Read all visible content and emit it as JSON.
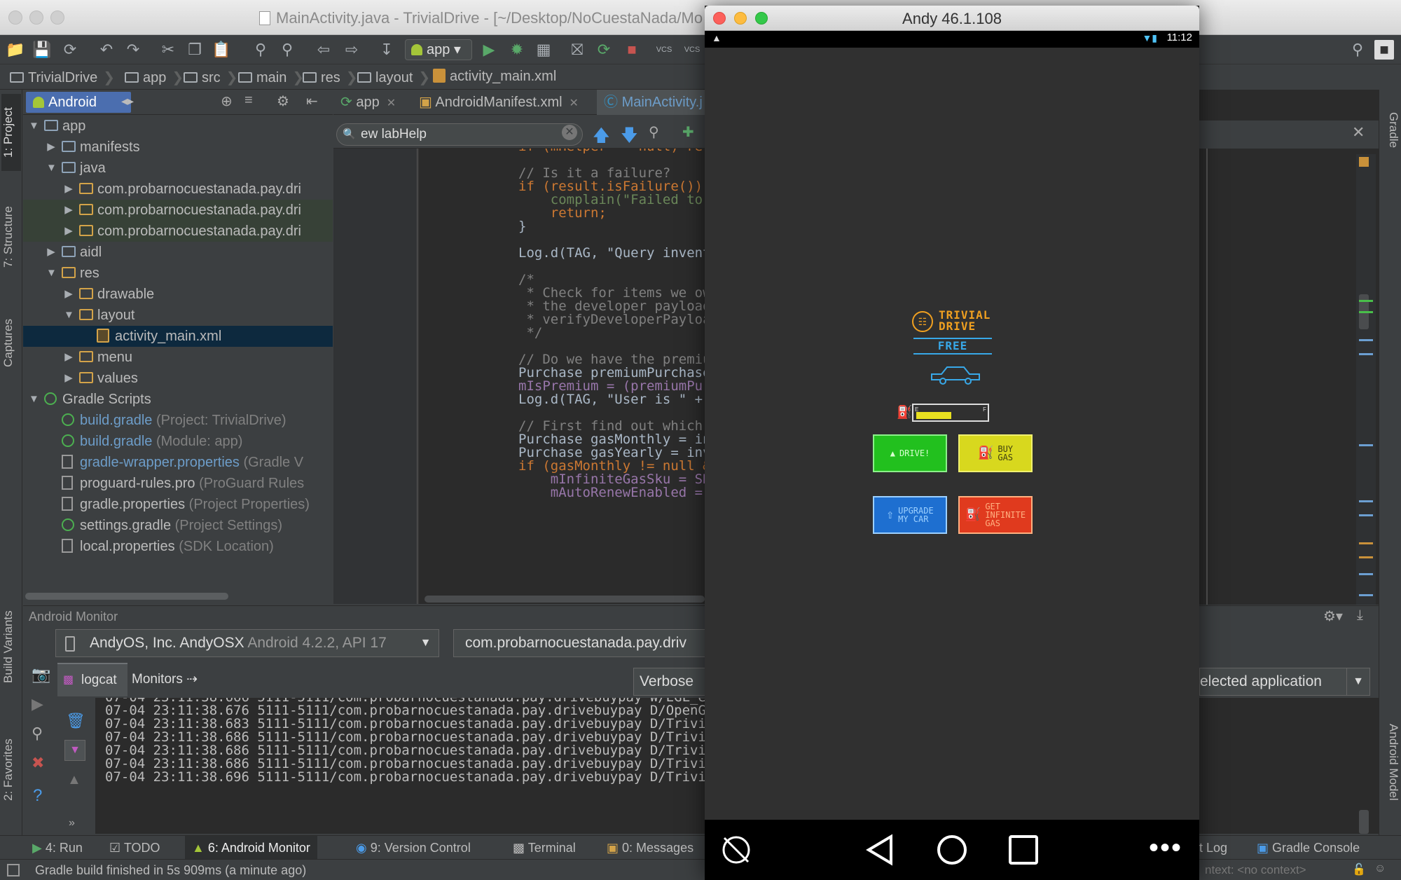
{
  "ide": {
    "window_title": "MainActivity.java - TrivialDrive - [~/Desktop/NoCuestaNada/Mo",
    "run_config": "app",
    "vcs_labels": [
      "VCS",
      "VCS"
    ],
    "breadcrumbs": [
      "TrivialDrive",
      "app",
      "src",
      "main",
      "res",
      "layout",
      "activity_main.xml"
    ],
    "left_tabs": [
      "1: Project",
      "7: Structure",
      "Captures",
      "Build Variants",
      "2: Favorites"
    ],
    "right_tabs": [
      "Gradle",
      "Android Model"
    ],
    "project_view": "Android",
    "tree": [
      {
        "label": "app",
        "hint": ""
      },
      {
        "label": "manifests",
        "hint": ""
      },
      {
        "label": "java",
        "hint": ""
      },
      {
        "label": "com.probarnocuestanada.pay.dri",
        "hint": ""
      },
      {
        "label": "com.probarnocuestanada.pay.dri",
        "hint": ""
      },
      {
        "label": "com.probarnocuestanada.pay.dri",
        "hint": ""
      },
      {
        "label": "aidl",
        "hint": ""
      },
      {
        "label": "res",
        "hint": ""
      },
      {
        "label": "drawable",
        "hint": ""
      },
      {
        "label": "layout",
        "hint": ""
      },
      {
        "label": "activity_main.xml",
        "hint": ""
      },
      {
        "label": "menu",
        "hint": ""
      },
      {
        "label": "values",
        "hint": ""
      },
      {
        "label": "Gradle Scripts",
        "hint": ""
      },
      {
        "label": "build.gradle",
        "hint": "(Project: TrivialDrive)"
      },
      {
        "label": "build.gradle",
        "hint": "(Module: app)"
      },
      {
        "label": "gradle-wrapper.properties",
        "hint": "(Gradle V"
      },
      {
        "label": "proguard-rules.pro",
        "hint": "(ProGuard Rules"
      },
      {
        "label": "gradle.properties",
        "hint": "(Project Properties)"
      },
      {
        "label": "settings.gradle",
        "hint": "(Project Settings)"
      },
      {
        "label": "local.properties",
        "hint": "(SDK Location)"
      }
    ],
    "editor_tabs": [
      "app",
      "AndroidManifest.xml",
      "MainActivity.j"
    ],
    "search_text": "ew labHelp",
    "code_lines": [
      "if (mHelper == null) ret",
      "",
      "// Is it a failure?",
      "if (result.isFailure())",
      "    complain(\"Failed to",
      "    return;",
      "}",
      "",
      "Log.d(TAG, \"Query invent",
      "",
      "/*",
      " * Check for items we ow",
      " * the developer payload",
      " * verifyDeveloperPayloa",
      " */",
      "",
      "// Do we have the premiu",
      "Purchase premiumPurchase",
      "mIsPremium = (premiumPur",
      "Log.d(TAG, \"User is \" +",
      "",
      "// First find out which",
      "Purchase gasMonthly = in",
      "Purchase gasYearly = inv",
      "if (gasMonthly != null &",
      "    mInfiniteGasSku = SK",
      "    mAutoRenewEnabled ="
    ],
    "monitor": {
      "title": "Android Monitor",
      "device": "AndyOS, Inc. AndyOSX",
      "device_detail": "Android 4.2.2, API 17",
      "process": "com.probarnocuestanada.pay.driv",
      "tab_logcat": "logcat",
      "tab_monitors": "Monitors",
      "log_level": "Verbose",
      "filter": "elected application",
      "log_lines": [
        "07-04 23:11:38.666 5111-5111/com.probarnocuestanada.pay.drivebuypay W/EGL_em",
        "07-04 23:11:38.676 5111-5111/com.probarnocuestanada.pay.drivebuypay D/OpenGL",
        "07-04 23:11:38.683 5111-5111/com.probarnocuestanada.pay.drivebuypay D/Trivia",
        "07-04 23:11:38.686 5111-5111/com.probarnocuestanada.pay.drivebuypay D/Trivia",
        "07-04 23:11:38.686 5111-5111/com.probarnocuestanada.pay.drivebuypay D/Trivia",
        "07-04 23:11:38.686 5111-5111/com.probarnocuestanada.pay.drivebuypay D/Trivia",
        "07-04 23:11:38.696 5111-5111/com.probarnocuestanada.pay.drivebuypay D/Trivia"
      ]
    },
    "tool_tabs": {
      "run": "4: Run",
      "todo": "TODO",
      "monitor": "6: Android Monitor",
      "vcs": "9: Version Control",
      "terminal": "Terminal",
      "messages": "0: Messages",
      "event_log": "t Log",
      "gradle_console": "Gradle Console"
    },
    "status": "Gradle build finished in 5s 909ms (a minute ago)",
    "context": "ntext: <no context>"
  },
  "emulator": {
    "title": "Andy 46.1.108",
    "clock": "11:12",
    "logo_line1": "TRIVIAL",
    "logo_line2": "DRIVE",
    "logo_free": "FREE",
    "gauge_empty": "E",
    "gauge_full": "F",
    "gauge_level": 0.5,
    "buttons": {
      "drive": "DRIVE!",
      "buy_gas": [
        "BUY",
        "GAS"
      ],
      "upgrade": [
        "UPGRADE",
        "MY CAR"
      ],
      "infinite": [
        "GET",
        "INFINITE",
        "GAS"
      ]
    },
    "colors": {
      "drive": "#22c01e",
      "buy_gas": "#d8d81e",
      "upgrade": "#1e6fd0",
      "infinite": "#e03a1e",
      "logo": "#f0a020",
      "free": "#38a8e8"
    }
  }
}
